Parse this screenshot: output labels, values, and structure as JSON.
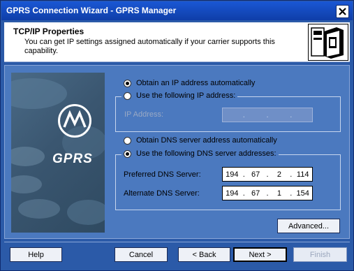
{
  "window": {
    "title": "GPRS Connection Wizard - GPRS Manager"
  },
  "header": {
    "title": "TCP/IP Properties",
    "description": "You can get IP settings assigned automatically if your carrier supports this capability."
  },
  "side_image": {
    "brand_text": "GPRS"
  },
  "ip": {
    "auto_label": "Obtain an IP address automatically",
    "auto_selected": true,
    "manual_label": "Use the following IP address:",
    "manual_selected": false,
    "address_label": "IP Address:",
    "address": [
      "",
      "",
      "",
      ""
    ]
  },
  "dns": {
    "auto_label": "Obtain DNS server address automatically",
    "auto_selected": false,
    "manual_label": "Use the following DNS server addresses:",
    "manual_selected": true,
    "preferred_label": "Preferred DNS Server:",
    "preferred": [
      "194",
      "67",
      "2",
      "114"
    ],
    "alternate_label": "Alternate DNS Server:",
    "alternate": [
      "194",
      "67",
      "1",
      "154"
    ]
  },
  "buttons": {
    "advanced": "Advanced...",
    "help": "Help",
    "cancel": "Cancel",
    "back": "< Back",
    "next": "Next >",
    "finish": "Finish"
  },
  "icons": {
    "close": "close-icon",
    "header": "wizard-header-icon",
    "logo": "motorola-logo-icon"
  }
}
